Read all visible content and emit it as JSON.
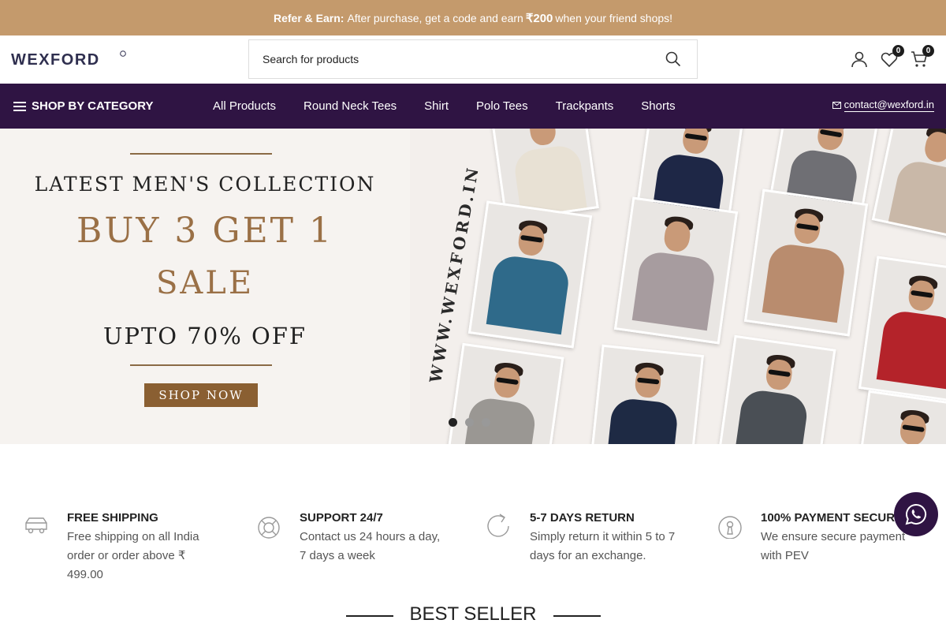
{
  "promo": {
    "lead": "Refer & Earn:",
    "text_before": "After purchase, get a code and earn",
    "amount": "₹200",
    "text_after": "when your friend shops!"
  },
  "header": {
    "logo_text": "WEXFORD",
    "search_placeholder": "Search for products",
    "wishlist_count": "0",
    "cart_count": "0"
  },
  "nav": {
    "category_label": "SHOP BY CATEGORY",
    "items": [
      "All Products",
      "Round Neck Tees",
      "Shirt",
      "Polo Tees",
      "Trackpants",
      "Shorts"
    ],
    "contact_email": "contact@wexford.in"
  },
  "banner": {
    "line1": "LATEST MEN'S COLLECTION",
    "line2": "BUY 3 GET 1",
    "line3": "SALE",
    "line4": "UPTO 70% OFF",
    "cta": "SHOP NOW",
    "url_text": "WWW.WEXFORD.IN",
    "slide_count": 3,
    "active_slide": 1
  },
  "features": [
    {
      "icon": "truck-icon",
      "title": "FREE SHIPPING",
      "desc": "Free shipping on all India order or order above ₹ 499.00"
    },
    {
      "icon": "lifebuoy-icon",
      "title": "SUPPORT 24/7",
      "desc": "Contact us 24 hours a day, 7 days a week"
    },
    {
      "icon": "return-arrow-icon",
      "title": "5-7 DAYS RETURN",
      "desc": "Simply return it within 5 to 7 days for an exchange."
    },
    {
      "icon": "lock-icon",
      "title": "100% PAYMENT SECURE",
      "desc": "We ensure secure payment with PEV"
    }
  ],
  "section": {
    "best_seller_title": "BEST SELLER"
  },
  "colors": {
    "promo_bg": "#c49a6c",
    "nav_bg": "#2f1443",
    "banner_accent": "#9a7046",
    "logo_orange": "#e8732a"
  }
}
